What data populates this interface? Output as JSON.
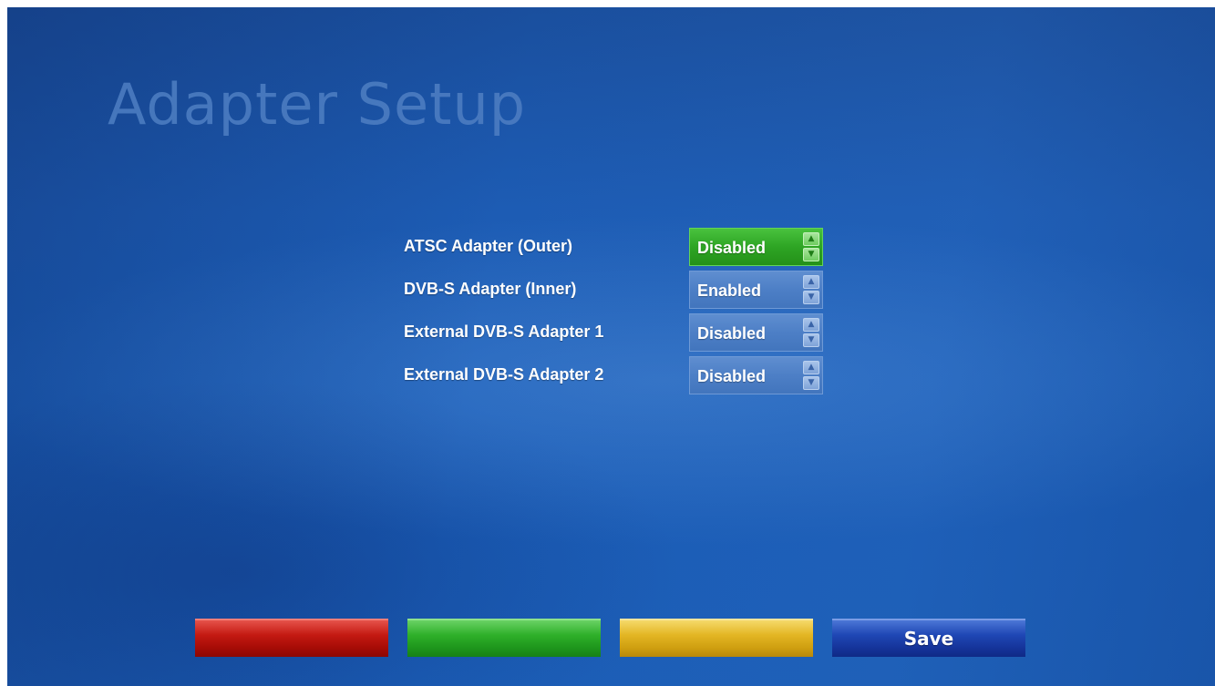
{
  "page": {
    "title": "Adapter Setup"
  },
  "settings": [
    {
      "label": "ATSC Adapter (Outer)",
      "value": "Disabled",
      "focused": true
    },
    {
      "label": "DVB-S Adapter (Inner)",
      "value": "Enabled",
      "focused": false
    },
    {
      "label": "External DVB-S Adapter 1",
      "value": "Disabled",
      "focused": false
    },
    {
      "label": "External DVB-S Adapter 2",
      "value": "Disabled",
      "focused": false
    }
  ],
  "icons": {
    "up": "chevron-up-icon",
    "down": "chevron-down-icon"
  },
  "buttons": {
    "red_label": "",
    "green_label": "",
    "yellow_label": "",
    "blue_label": "Save"
  },
  "colors": {
    "focus_green": "#2ea524",
    "spinner_blue": "#4d7fc6",
    "red": "#c41a12",
    "green": "#2fb02a",
    "yellow": "#e3b624",
    "blue": "#1f47b5"
  }
}
